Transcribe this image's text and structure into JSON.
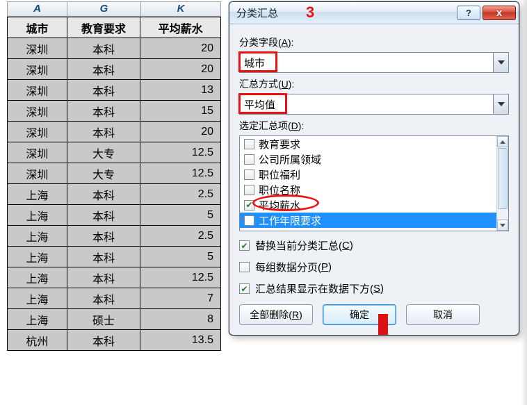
{
  "spreadsheet": {
    "column_letters": {
      "a": "A",
      "g": "G",
      "k": "K"
    },
    "headers": {
      "city": "城市",
      "edu": "教育要求",
      "salary": "平均薪水"
    },
    "rows": [
      {
        "city": "深圳",
        "edu": "本科",
        "salary": "20"
      },
      {
        "city": "深圳",
        "edu": "本科",
        "salary": "20"
      },
      {
        "city": "深圳",
        "edu": "本科",
        "salary": "13"
      },
      {
        "city": "深圳",
        "edu": "本科",
        "salary": "15"
      },
      {
        "city": "深圳",
        "edu": "本科",
        "salary": "20"
      },
      {
        "city": "深圳",
        "edu": "大专",
        "salary": "12.5"
      },
      {
        "city": "深圳",
        "edu": "大专",
        "salary": "12.5"
      },
      {
        "city": "上海",
        "edu": "本科",
        "salary": "2.5"
      },
      {
        "city": "上海",
        "edu": "本科",
        "salary": "5"
      },
      {
        "city": "上海",
        "edu": "本科",
        "salary": "2.5"
      },
      {
        "city": "上海",
        "edu": "本科",
        "salary": "5"
      },
      {
        "city": "上海",
        "edu": "本科",
        "salary": "12.5"
      },
      {
        "city": "上海",
        "edu": "本科",
        "salary": "7"
      },
      {
        "city": "上海",
        "edu": "硕士",
        "salary": "8"
      },
      {
        "city": "杭州",
        "edu": "本科",
        "salary": "13.5"
      }
    ]
  },
  "dialog": {
    "title": "分类汇总",
    "annotation_number": "3",
    "labels": {
      "group_field": "分类字段(",
      "group_field_key": "A",
      "group_field_tail": "):",
      "summary_mode": "汇总方式(",
      "summary_mode_key": "U",
      "summary_mode_tail": "):",
      "summary_items": "选定汇总项(",
      "summary_items_key": "D",
      "summary_items_tail": "):"
    },
    "group_field_value": "城市",
    "summary_mode_value": "平均值",
    "summary_list": {
      "items": [
        {
          "label": "教育要求",
          "checked": false,
          "selected": false
        },
        {
          "label": "公司所属领域",
          "checked": false,
          "selected": false
        },
        {
          "label": "职位福利",
          "checked": false,
          "selected": false
        },
        {
          "label": "职位名称",
          "checked": false,
          "selected": false
        },
        {
          "label": "平均薪水",
          "checked": true,
          "selected": false
        },
        {
          "label": "工作年限要求",
          "checked": false,
          "selected": true
        }
      ]
    },
    "checkboxes": {
      "replace": {
        "pre": "替换当前分类汇总(",
        "key": "C",
        "post": ")",
        "checked": true
      },
      "pagebreak": {
        "pre": "每组数据分页(",
        "key": "P",
        "post": ")",
        "checked": false
      },
      "below": {
        "pre": "汇总结果显示在数据下方(",
        "key": "S",
        "post": ")",
        "checked": true
      }
    },
    "buttons": {
      "remove_all_pre": "全部删除(",
      "remove_all_key": "R",
      "remove_all_post": ")",
      "ok": "确定",
      "cancel": "取消"
    },
    "winbuttons": {
      "help": "?",
      "close": "x"
    }
  }
}
